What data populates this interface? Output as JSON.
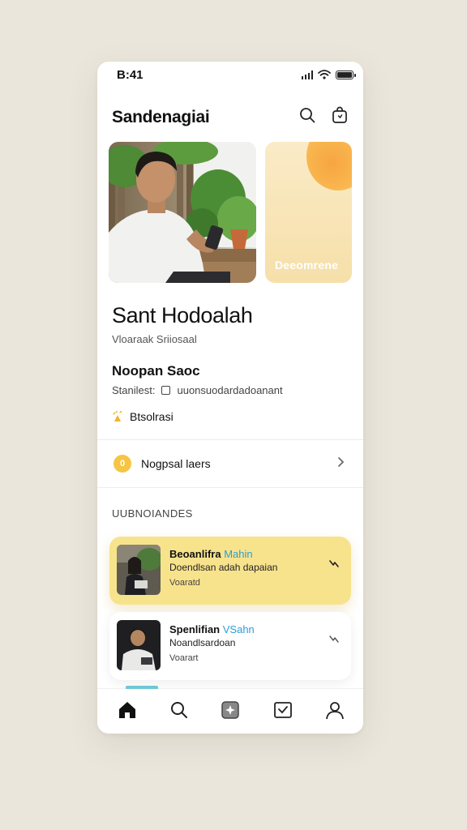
{
  "status_bar": {
    "time": "B:41"
  },
  "header": {
    "title": "Sandenagiai"
  },
  "hero": {
    "card_label": "Deeomrene"
  },
  "profile": {
    "name": "Sant Hodoalah",
    "subtitle": "Vloaraak Sriiosaal"
  },
  "details": {
    "title": "Noopan Saoc",
    "meta_prefix": "Stanilest:",
    "meta_value": "uuonsuodardadoanant",
    "tag": "Btsolrasi"
  },
  "link_row": {
    "badge": "0",
    "label": "Nogpsal laers"
  },
  "list": {
    "heading": "UUBNOIANDES",
    "items": [
      {
        "title": "Beoanlifra",
        "title_accent": "Mahin",
        "desc": "Doendlsan adah dapaian",
        "meta": "Voaratd"
      },
      {
        "title": "Spenlifian",
        "title_accent": "VSahn",
        "desc": "Noandlsardoan",
        "meta": "Voarart"
      }
    ]
  },
  "colors": {
    "background": "#ebe6dc",
    "active_card": "#f8e38d",
    "accent_blue": "#2b9ed8",
    "coin": "#f6c544"
  },
  "icons": [
    "search-icon",
    "bag-icon",
    "chevron-right-icon",
    "home-icon",
    "explore-icon",
    "sparkle-icon",
    "inbox-icon",
    "profile-icon"
  ]
}
